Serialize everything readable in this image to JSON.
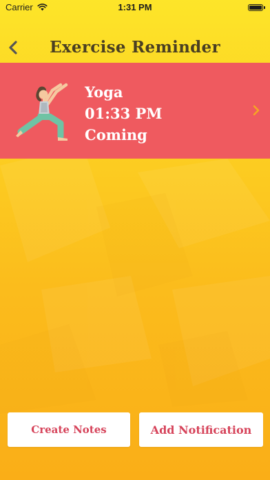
{
  "status_bar": {
    "carrier": "Carrier",
    "time": "1:31 PM"
  },
  "nav": {
    "title": "Exercise Reminder",
    "back_icon": "chevron-left-icon"
  },
  "reminder": {
    "name": "Yoga",
    "time": "01:33 PM",
    "status": "Coming",
    "icon": "yoga-pose-icon",
    "background_color": "#ef5a5f",
    "chevron_color": "#f5a623"
  },
  "actions": {
    "create_notes_label": "Create Notes",
    "add_notification_label": "Add Notification",
    "label_color": "#d6435a"
  }
}
